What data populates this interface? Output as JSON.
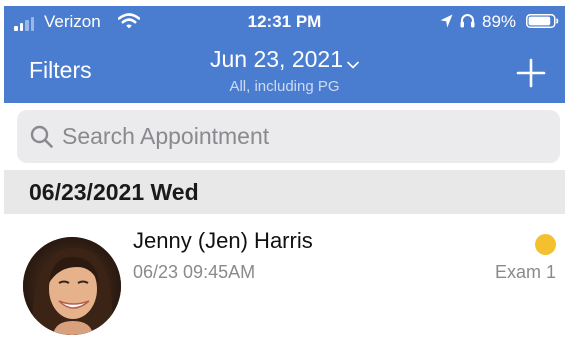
{
  "status_bar": {
    "carrier": "Verizon",
    "signal_bars_active": 2,
    "signal_bars_total": 4,
    "time": "12:31 PM",
    "battery_percent": "89%",
    "battery_level": 0.89
  },
  "nav": {
    "filters_label": "Filters",
    "date_title": "Jun 23, 2021",
    "date_subtitle": "All, including PG",
    "add_icon": "plus-icon"
  },
  "search": {
    "placeholder": "Search Appointment",
    "value": ""
  },
  "section": {
    "date_label": "06/23/2021 Wed"
  },
  "appointments": [
    {
      "name": "Jenny (Jen) Harris",
      "datetime": "06/23 09:45AM",
      "room": "Exam 1",
      "status_color": "#f5c02f"
    }
  ],
  "colors": {
    "header_bg": "#4a7dcf",
    "search_bg": "#ebebed",
    "section_bg": "#e8e8e8",
    "status_dot": "#f5c02f"
  }
}
